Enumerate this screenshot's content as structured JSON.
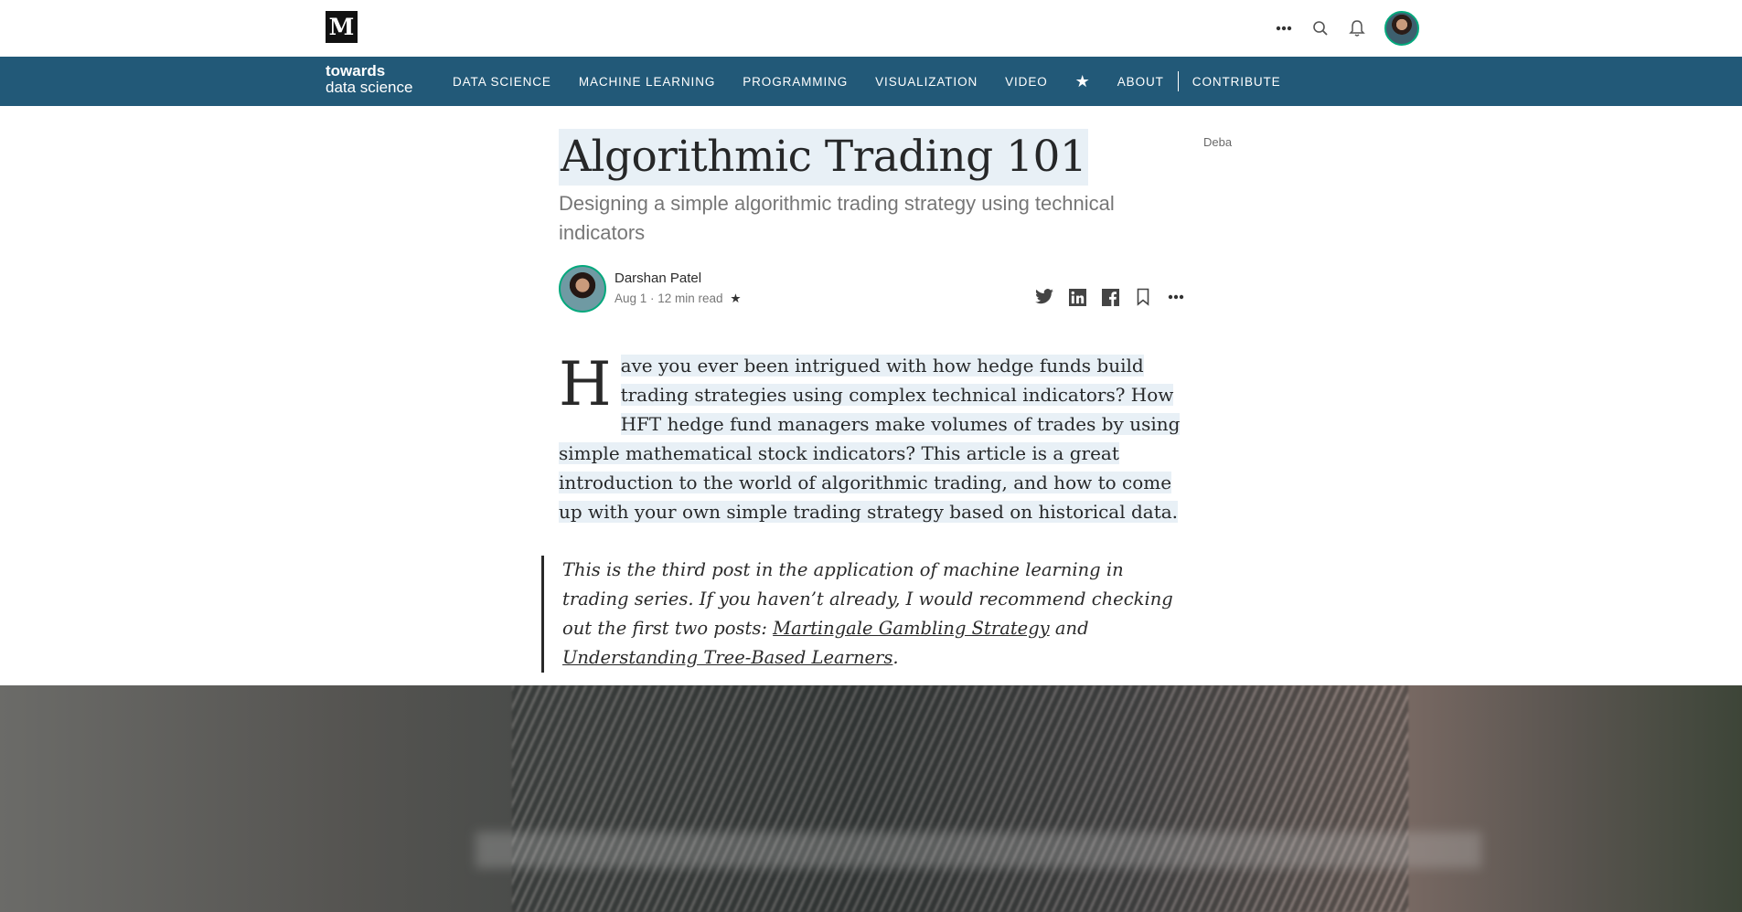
{
  "topbar": {
    "logo_letter": "M",
    "icons": [
      "more-icon",
      "search-icon",
      "bell-icon"
    ]
  },
  "publication": {
    "logo_line1": "towards",
    "logo_line2": "data science",
    "nav": [
      "DATA SCIENCE",
      "MACHINE LEARNING",
      "PROGRAMMING",
      "VISUALIZATION",
      "VIDEO"
    ],
    "star": "★",
    "about": "ABOUT",
    "contribute": "CONTRIBUTE"
  },
  "article": {
    "title": "Algorithmic Trading 101",
    "side_text": "Deba",
    "subtitle": "Designing a simple algorithmic trading strategy using technical indicators",
    "author": "Darshan Patel",
    "meta": "Aug 1 · 12 min read",
    "meta_star": "★",
    "dropcap": "H",
    "body": "ave you ever been intrigued with how hedge funds build trading strategies using complex technical indicators? How HFT hedge fund managers make volumes of trades by using simple mathematical stock indicators? This article is a great introduction to the world of algorithmic trading, and how to come up with your own simple trading strategy based on historical data.",
    "quote_text": "This is the third post in the application of machine learning in trading series. If you haven’t already, I would recommend checking out the first two posts: ",
    "quote_link1": "Martingale Gambling Strategy",
    "quote_and": " and ",
    "quote_link2": "Understanding Tree-Based Learners",
    "quote_end": "."
  },
  "colors": {
    "nav_bg": "#225978",
    "highlight": "#e8f0f6",
    "accent_green": "#03a87c"
  }
}
